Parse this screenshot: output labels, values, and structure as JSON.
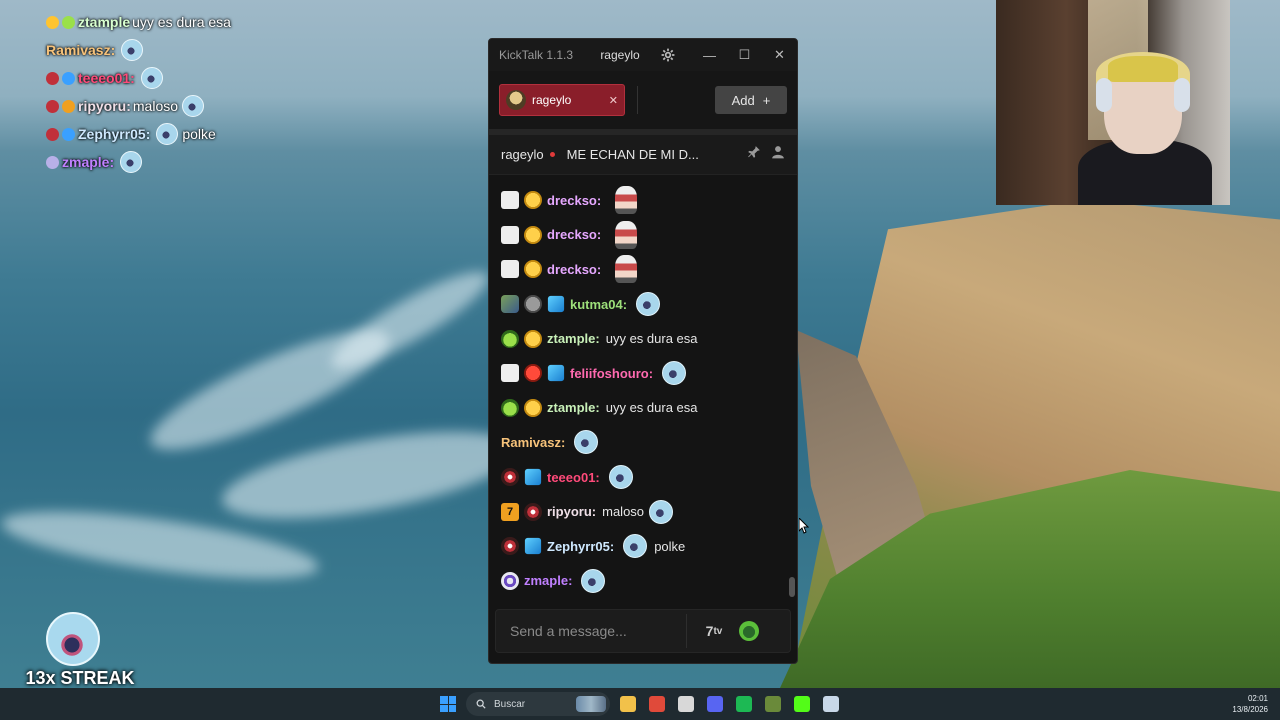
{
  "overlay": {
    "messages": [
      {
        "name": "ztample",
        "name_color": "#d8ffd0",
        "text": "uyy es dura esa",
        "badges": [
          "#ffc430",
          "#9ae04a"
        ],
        "emote": false
      },
      {
        "name": "Ramivasz:",
        "name_color": "#f6c27a",
        "text": "",
        "badges": [],
        "emote": true
      },
      {
        "name": "teeeo01:",
        "name_color": "#ff4a7a",
        "text": "",
        "badges": [
          "#c0303a",
          "#3aa0ff"
        ],
        "emote": true
      },
      {
        "name": "ripyoru:",
        "name_color": "#f0e0e8",
        "text": "maloso",
        "badges": [
          "#c0303a",
          "#f0a020"
        ],
        "emote": true,
        "emote_before_text": false
      },
      {
        "name": "Zephyrr05:",
        "name_color": "#cfe9ff",
        "text": "polke",
        "badges": [
          "#c0303a",
          "#3aa0ff"
        ],
        "emote": true,
        "emote_before_text": true
      },
      {
        "name": "zmaple:",
        "name_color": "#c080ff",
        "text": "",
        "badges": [
          "#b8b0e8"
        ],
        "emote": true
      }
    ]
  },
  "streak": {
    "label": "13x STREAK"
  },
  "kicktalk": {
    "app_title": "KickTalk 1.1.3",
    "user": "rageylo",
    "icons": {
      "settings": "gear-icon",
      "minimize": "minimize-icon",
      "maximize": "maximize-icon",
      "close": "close-icon"
    },
    "tab": {
      "label": "rageylo",
      "close_glyph": "✕"
    },
    "add_button": {
      "label": "Add",
      "glyph": "+"
    },
    "channel": {
      "name": "rageylo",
      "title": "ME ECHAN DE MI D..."
    },
    "messages": [
      {
        "name": "drecksо:",
        "name_color": "#e6a8ff",
        "badges": [
          "b-gift",
          "b-gold"
        ],
        "text": "",
        "emote": "man"
      },
      {
        "name": "drecksо:",
        "name_color": "#e6a8ff",
        "badges": [
          "b-gift",
          "b-gold"
        ],
        "text": "",
        "emote": "man"
      },
      {
        "name": "drecksо:",
        "name_color": "#e6a8ff",
        "badges": [
          "b-gift",
          "b-gold"
        ],
        "text": "",
        "emote": "man"
      },
      {
        "name": "kutma04:",
        "name_color": "#9de07a",
        "badges": [
          "b-img",
          "b-grey",
          "b-cube"
        ],
        "text": "",
        "emote": "face"
      },
      {
        "name": "ztample:",
        "name_color": "#c8f0b8",
        "badges": [
          "b-alien",
          "b-gold"
        ],
        "text": "uyy es dura esa",
        "emote": ""
      },
      {
        "name": "feliifoshouro:",
        "name_color": "#ff6ab0",
        "badges": [
          "b-gift",
          "b-red",
          "b-cube"
        ],
        "text": "",
        "emote": "face"
      },
      {
        "name": "ztample:",
        "name_color": "#c8f0b8",
        "badges": [
          "b-alien",
          "b-gold"
        ],
        "text": "uyy es dura esa",
        "emote": ""
      },
      {
        "name": "Ramivasz:",
        "name_color": "#f6c27a",
        "badges": [],
        "text": "",
        "emote": "face"
      },
      {
        "name": "teeeo01:",
        "name_color": "#ff4a7a",
        "badges": [
          "b-mouth",
          "b-cube"
        ],
        "text": "",
        "emote": "face"
      },
      {
        "name": "ripyoru:",
        "name_color": "#f0e0e8",
        "badges": [
          "b-7tv",
          "b-mouth"
        ],
        "text": "maloso",
        "emote": "face-after"
      },
      {
        "name": "Zephyrr05:",
        "name_color": "#cfe9ff",
        "badges": [
          "b-mouth",
          "b-cube"
        ],
        "text": "polke",
        "emote": "face-before"
      },
      {
        "name": "zmaple:",
        "name_color": "#c080ff",
        "badges": [
          "b-ring"
        ],
        "text": "",
        "emote": "face"
      }
    ],
    "input": {
      "placeholder": "Send a message...",
      "seventv_glyph": "7"
    }
  },
  "taskbar": {
    "search_label": "Buscar",
    "apps": [
      {
        "name": "file-explorer-icon",
        "color": "#f2c14a"
      },
      {
        "name": "chrome-icon",
        "color": "#e04a3a"
      },
      {
        "name": "app-icon",
        "color": "#d8d8d8"
      },
      {
        "name": "discord-icon",
        "color": "#5865f2"
      },
      {
        "name": "spotify-icon",
        "color": "#1db954"
      },
      {
        "name": "minecraft-icon",
        "color": "#6a8a3a"
      },
      {
        "name": "kick-icon",
        "color": "#53fc18"
      },
      {
        "name": "steam-icon",
        "color": "#c8d8e8"
      }
    ],
    "time": "02:01",
    "date": "13/8/2026"
  }
}
